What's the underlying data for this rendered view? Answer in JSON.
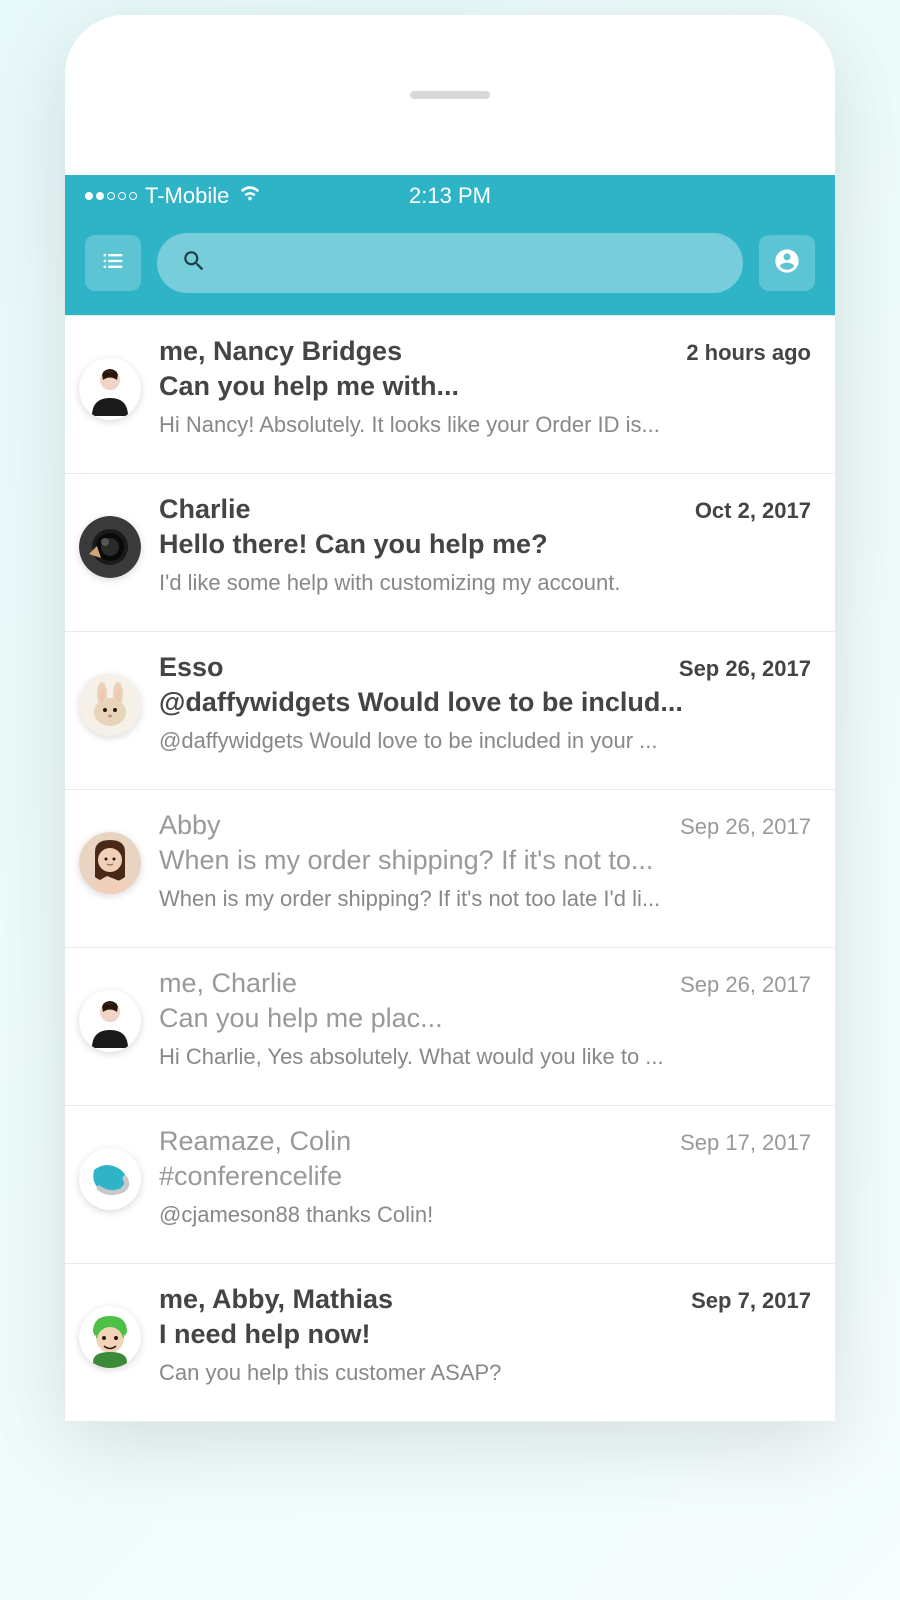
{
  "status_bar": {
    "carrier": "T-Mobile",
    "time": "2:13 PM"
  },
  "conversations": [
    {
      "participants": "me, Nancy Bridges",
      "timestamp": "2 hours ago",
      "subject": "Can you help me with...",
      "preview": "Hi Nancy! Absolutely. It looks like your Order ID is...",
      "read": false,
      "avatar": "person1"
    },
    {
      "participants": "Charlie",
      "timestamp": "Oct 2, 2017",
      "subject": "Hello there! Can you help me?",
      "preview": "I'd like some help with customizing my account.",
      "read": false,
      "avatar": "camera"
    },
    {
      "participants": "Esso",
      "timestamp": "Sep 26, 2017",
      "subject": "@daffywidgets Would love to be includ...",
      "preview": "@daffywidgets Would love to be included in your ...",
      "read": false,
      "avatar": "bunny"
    },
    {
      "participants": "Abby",
      "timestamp": "Sep 26, 2017",
      "subject": "When is my order shipping? If it's not to...",
      "preview": "When is my order shipping? If it's not too late I'd li...",
      "read": true,
      "avatar": "woman"
    },
    {
      "participants": "me, Charlie",
      "timestamp": "Sep 26, 2017",
      "subject": "Can you help me plac...",
      "preview": "Hi Charlie, Yes absolutely. What would you like to ...",
      "read": true,
      "avatar": "person1"
    },
    {
      "participants": "Reamaze, Colin",
      "timestamp": "Sep 17, 2017",
      "subject": "#conferencelife",
      "preview": "@cjameson88 thanks Colin!",
      "read": true,
      "avatar": "reamaze"
    },
    {
      "participants": "me, Abby, Mathias",
      "timestamp": "Sep 7, 2017",
      "subject": "I need help now!",
      "preview": "Can you help this customer ASAP?",
      "read": false,
      "avatar": "greenhair"
    }
  ]
}
